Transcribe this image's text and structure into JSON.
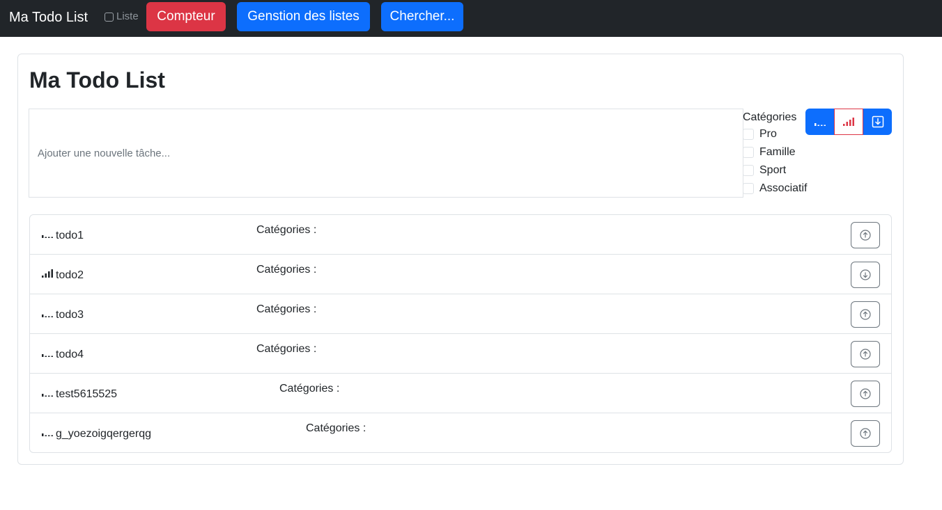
{
  "navbar": {
    "brand": "Ma Todo List",
    "checkbox_label": "Liste",
    "buttons": [
      "Compteur",
      "Genstion des listes",
      "Chercher..."
    ]
  },
  "main": {
    "title": "Ma Todo List",
    "input_placeholder": "Ajouter une nouvelle tâche...",
    "categories_title": "Catégories",
    "categories": [
      "Pro",
      "Famille",
      "Sport",
      "Associatif"
    ]
  },
  "todos": [
    {
      "name": "todo1",
      "categories_label": "Catégories :",
      "priority": "low",
      "action": "up"
    },
    {
      "name": "todo2",
      "categories_label": "Catégories :",
      "priority": "high",
      "action": "down"
    },
    {
      "name": "todo3",
      "categories_label": "Catégories :",
      "priority": "low",
      "action": "up"
    },
    {
      "name": "todo4",
      "categories_label": "Catégories :",
      "priority": "low",
      "action": "up"
    },
    {
      "name": "test5615525",
      "categories_label": "Catégories :",
      "priority": "low",
      "action": "up"
    },
    {
      "name": "g_yoezoigqergerqg",
      "categories_label": "Catégories :",
      "priority": "low",
      "action": "up"
    }
  ],
  "colors": {
    "navbar": "#212529",
    "danger": "#dc3545",
    "primary": "#0d6efd"
  }
}
